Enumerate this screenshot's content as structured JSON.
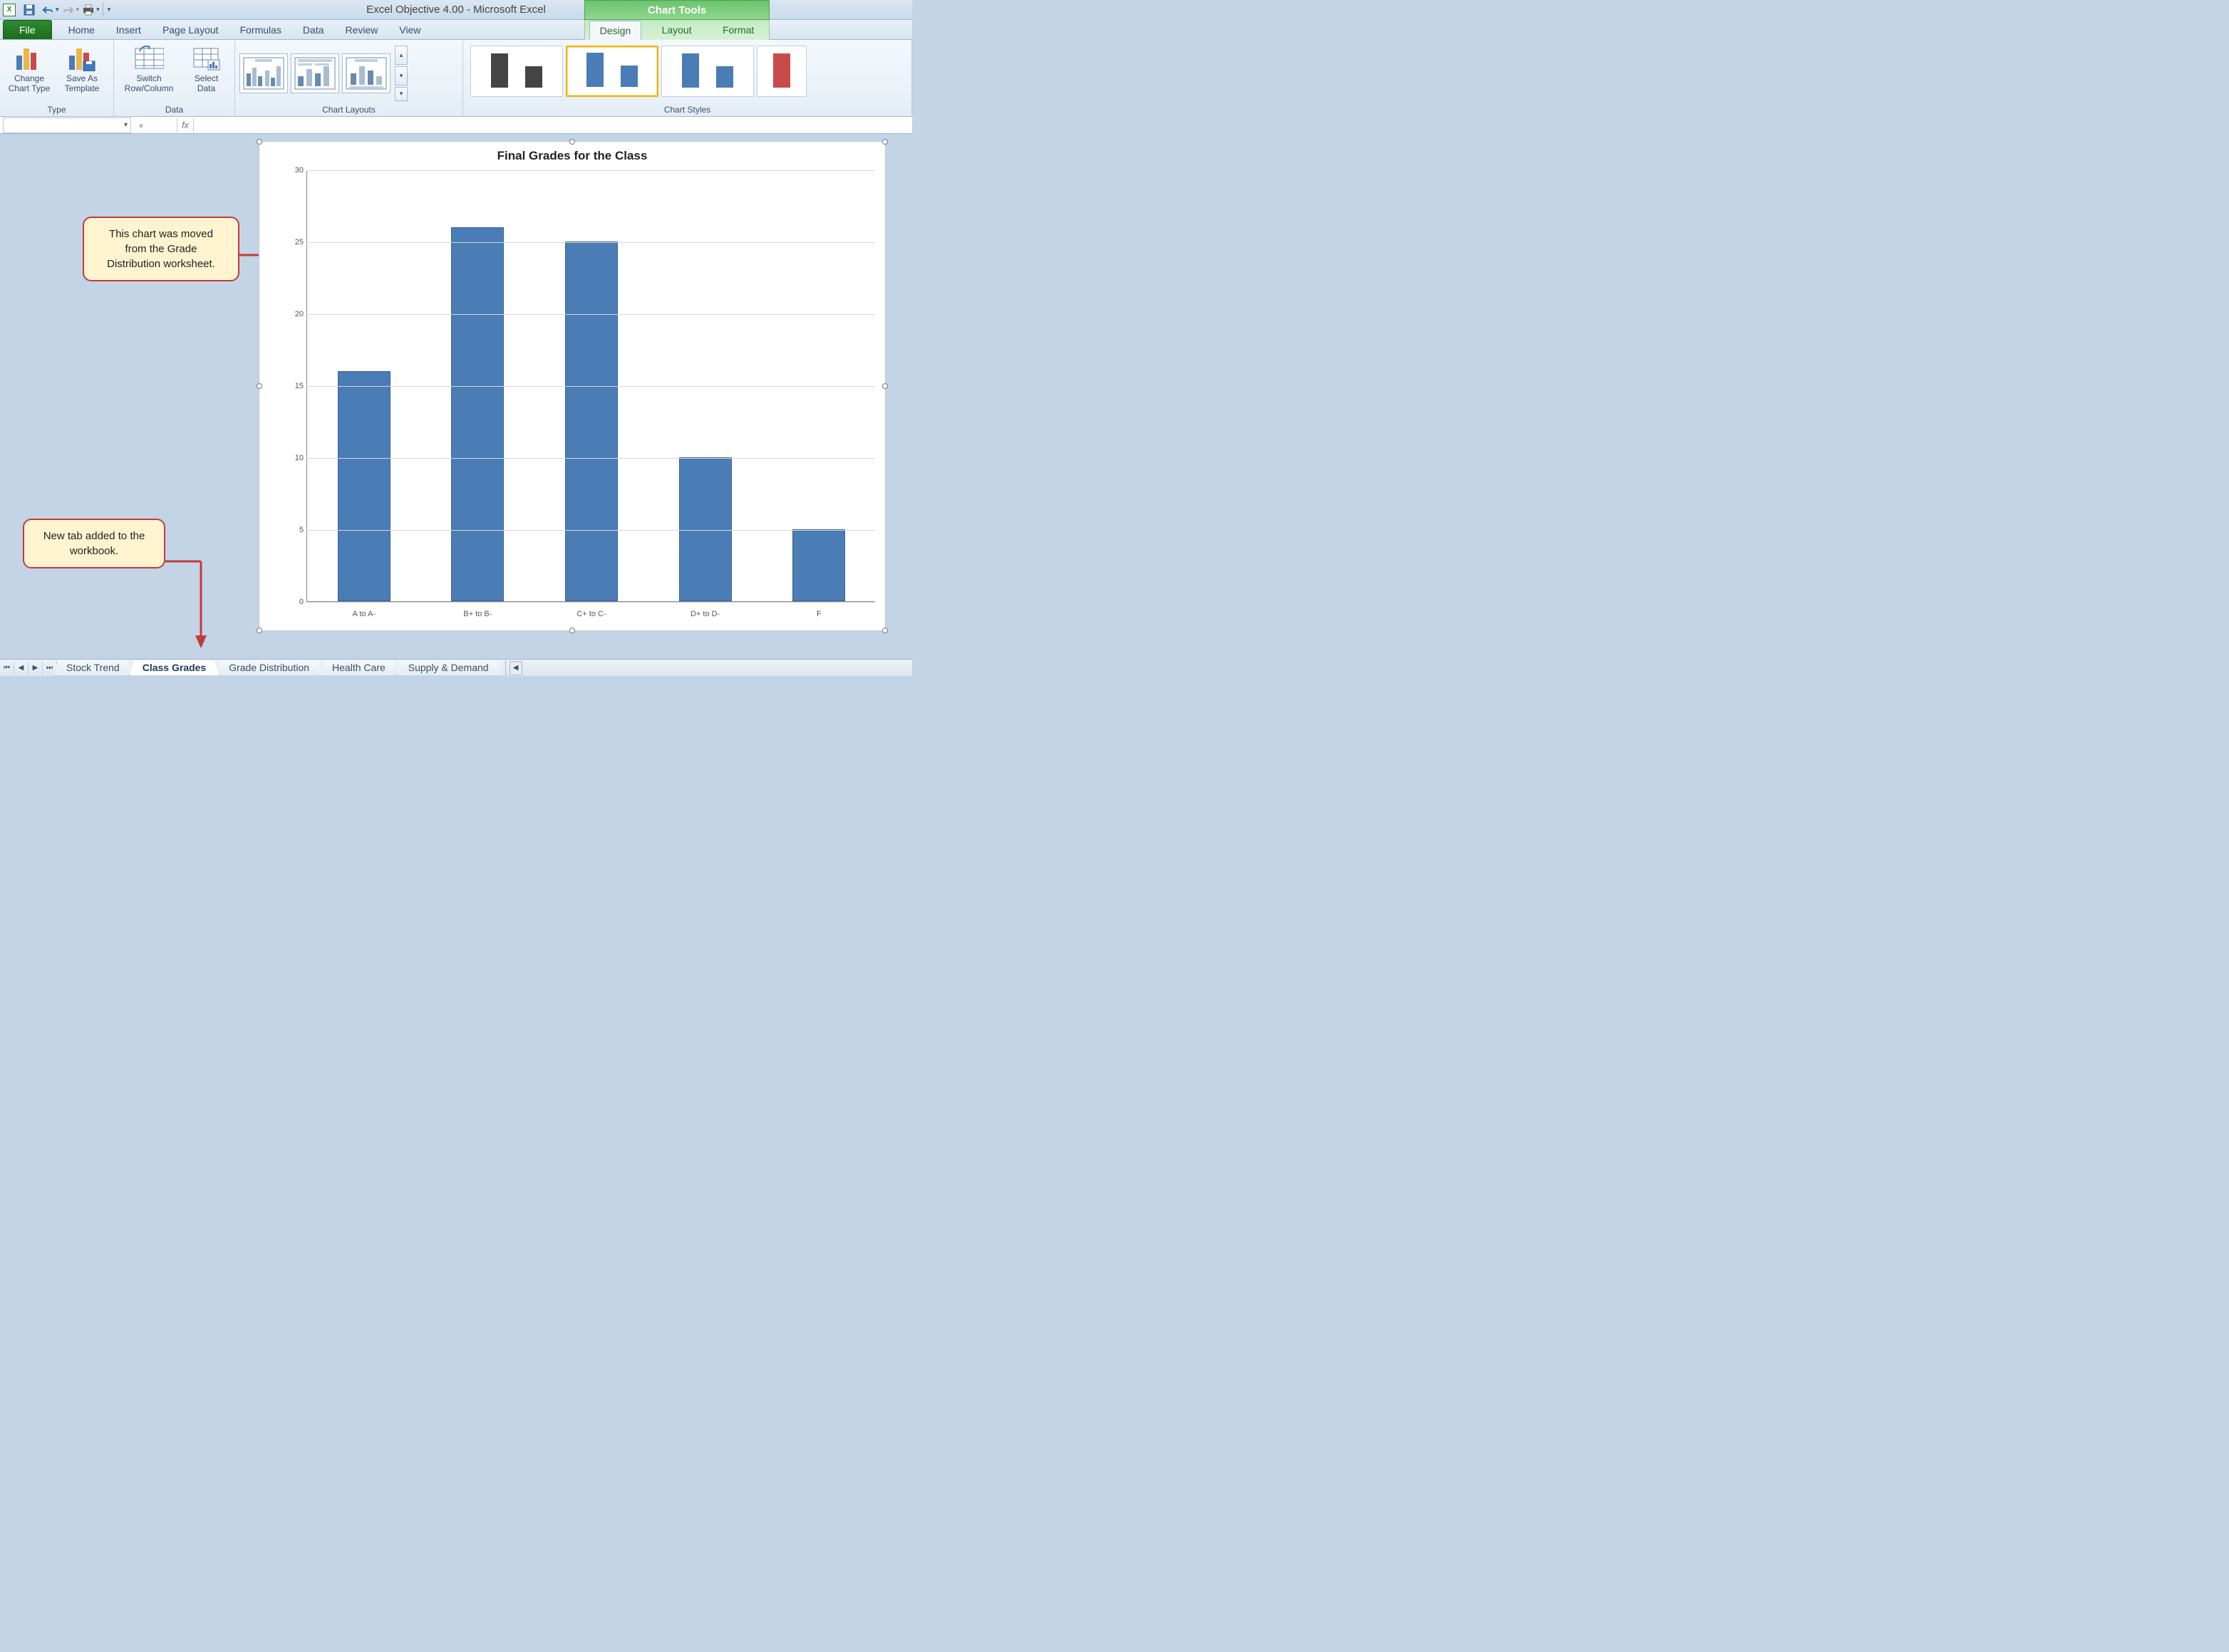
{
  "qat": {
    "app_icon_letter": "X",
    "title": "Excel Objective 4.00 - Microsoft Excel",
    "context_label": "Chart Tools"
  },
  "tabs": {
    "file": "File",
    "items": [
      "Home",
      "Insert",
      "Page Layout",
      "Formulas",
      "Data",
      "Review",
      "View"
    ],
    "context_items": [
      "Design",
      "Layout",
      "Format"
    ],
    "active": "Design"
  },
  "ribbon": {
    "type": {
      "label": "Type",
      "change_chart_type": "Change Chart Type",
      "save_as_template": "Save As Template"
    },
    "data": {
      "label": "Data",
      "switch": "Switch Row/Column",
      "select": "Select Data"
    },
    "chart_layouts": {
      "label": "Chart Layouts"
    },
    "chart_styles": {
      "label": "Chart Styles"
    }
  },
  "formula_bar": {
    "name_box": "",
    "fx": "fx",
    "value": ""
  },
  "callouts": {
    "c1": "This chart was moved from the Grade Distribution worksheet.",
    "c2": "New tab added to the workbook."
  },
  "chart_data": {
    "type": "bar",
    "title": "Final Grades for the Class",
    "categories": [
      "A to A-",
      "B+ to B-",
      "C+ to C-",
      "D+ to D-",
      "F"
    ],
    "values": [
      16,
      26,
      25,
      10,
      5
    ],
    "ylim": [
      0,
      30
    ],
    "yticks": [
      0,
      5,
      10,
      15,
      20,
      25,
      30
    ],
    "xlabel": "",
    "ylabel": ""
  },
  "sheet_tabs": {
    "items": [
      "Stock Trend",
      "Class Grades",
      "Grade Distribution",
      "Health Care",
      "Supply & Demand"
    ],
    "active": "Class Grades"
  }
}
